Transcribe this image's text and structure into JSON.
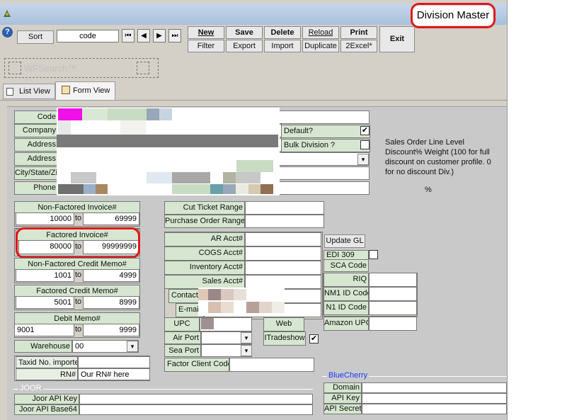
{
  "window": {
    "title": "Division Master"
  },
  "toolbar": {
    "help": "?",
    "sort_label": "Sort",
    "sort_field_value": "code",
    "nav": {
      "first": "⏮",
      "prev": "◀",
      "next": "▶",
      "last": "⏭"
    },
    "buttons": {
      "new": "New",
      "save": "Save",
      "delete": "Delete",
      "reload": "Reload",
      "print": "Print",
      "filter": "Filter",
      "export": "Export",
      "import": "Import",
      "duplicate": "Duplicate",
      "excel": "2Excel*",
      "exit": "Exit"
    },
    "search_placeholder": "WFSearch™"
  },
  "tabs": {
    "list_view": "List View",
    "form_view": "Form View"
  },
  "form": {
    "code_label": "Code",
    "company_label": "Company",
    "address1_label": "Address",
    "address2_label": "Address",
    "citystate_label": "City/State/Zip",
    "phone_label": "Phone",
    "default_label": "Default?",
    "default_checked": "✔",
    "bulk_label": "Bulk Division ?",
    "note": "Sales Order Line Level Discount% Weight (100 for full discount on customer profile. 0 for no discount Div.)",
    "percent": "%",
    "nonfact_inv": {
      "label": "Non-Factored Invoice#",
      "from": "10000",
      "to_label": "to",
      "to": "69999"
    },
    "fact_inv": {
      "label": "Factored Invoice#",
      "from": "80000",
      "to_label": "to",
      "to": "99999999"
    },
    "nonfact_cm": {
      "label": "Non-Factored Credit Memo#",
      "from": "1001",
      "to_label": "to",
      "to": "4999"
    },
    "fact_cm": {
      "label": "Factored Credit Memo#",
      "from": "5001",
      "to_label": "to",
      "to": "8999"
    },
    "debit": {
      "label": "Debit Memo#",
      "from": "9001",
      "to_label": "to",
      "to": "9999"
    },
    "warehouse_label": "Warehouse",
    "warehouse_value": "00",
    "taxid_label": "Taxid No. importer",
    "rn_label": "RN#",
    "rn_value": "Our RN# here",
    "cut_ticket_label": "Cut Ticket Range",
    "po_range_label": "Purchase Order Range",
    "ar_label": "AR Acct#",
    "cogs_label": "COGS Acct#",
    "inv_acct_label": "Inventory Acct#",
    "sales_acct_label": "Sales Acct#",
    "contact_label": "Contact",
    "email_label": "E-mail",
    "upc_label": "UPC",
    "web_label": "Web",
    "air_port_label": "Air Port",
    "itradeshow_label": "ITradeshow",
    "itradeshow_checked": "✔",
    "sea_port_label": "Sea Port",
    "factor_client_label": "Factor Client Code",
    "update_gl": "Update GL",
    "edi_label": "EDI 309",
    "sca_label": "SCA Code",
    "riq_label": "RIQ",
    "nm1_label": "NM1 ID Code",
    "n1_label": "N1 ID Code",
    "amazon_upc_label": "Amazon UPC",
    "joor_section": "JOOR",
    "joor_key_label": "Joor API Key",
    "joor_base_label": "Joor API Base64",
    "bluecherry_section": "BlueCherry",
    "domain_label": "Domain",
    "api_key_label": "API Key",
    "api_secret_label": "API Secret"
  },
  "colors": {
    "highlight": "#e01818",
    "label_bg": "#d6e6d0",
    "section_blue": "#1a3aff"
  }
}
